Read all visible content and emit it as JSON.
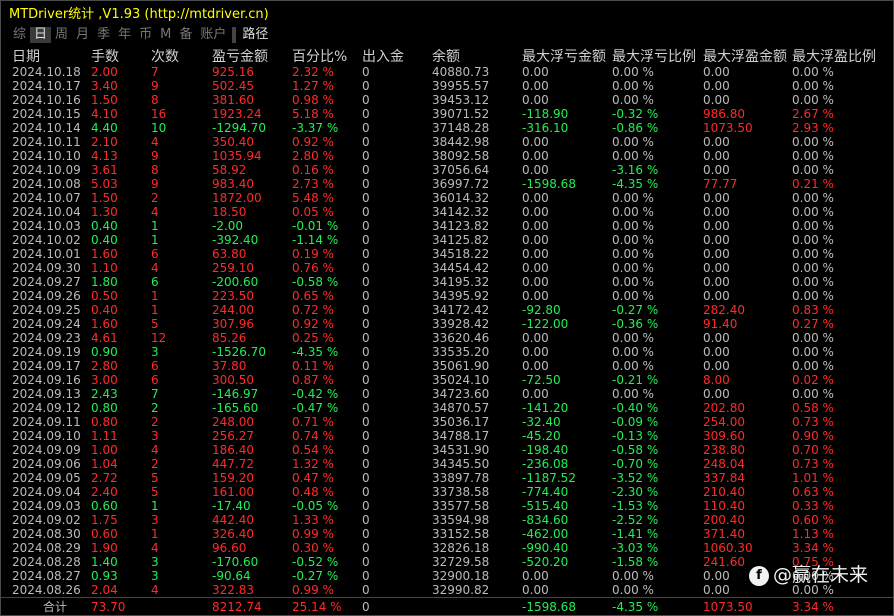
{
  "title": "MTDriver统计 ,V1.93 (http://mtdriver.cn)",
  "tabs": [
    {
      "label": "综",
      "state": "dim"
    },
    {
      "label": "日",
      "state": "sel"
    },
    {
      "label": "周",
      "state": "dim"
    },
    {
      "label": "月",
      "state": "dim"
    },
    {
      "label": "季",
      "state": "dim"
    },
    {
      "label": "年",
      "state": "dim"
    },
    {
      "label": "币",
      "state": "dim"
    },
    {
      "label": "M",
      "state": "dim"
    },
    {
      "label": "备",
      "state": "dim"
    },
    {
      "label": "账户",
      "state": "dim"
    },
    {
      "label": "路径",
      "state": "hl"
    }
  ],
  "columns": [
    "日期",
    "手数",
    "次数",
    "盈亏金额",
    "百分比%",
    "出入金",
    "余额",
    "最大浮亏金额",
    "最大浮亏比例",
    "最大浮盈金额",
    "最大浮盈比例"
  ],
  "colors": {
    "profit": "#ff2a2a",
    "loss": "#22ee55",
    "neutral": "#bbbbbb",
    "title": "#ffff00"
  },
  "rows": [
    {
      "date": "2024.10.18",
      "lots": "2.00",
      "count": "7",
      "pnl": "925.16",
      "pct": "2.32 %",
      "flow": "0",
      "bal": "40880.73",
      "mfl": "0.00",
      "mflp": "0.00 %",
      "mfp": "0.00",
      "mfpp": "0.00 %",
      "dir": "red",
      "fl": "gray",
      "fp": "gray"
    },
    {
      "date": "2024.10.17",
      "lots": "3.40",
      "count": "9",
      "pnl": "502.45",
      "pct": "1.27 %",
      "flow": "0",
      "bal": "39955.57",
      "mfl": "0.00",
      "mflp": "0.00 %",
      "mfp": "0.00",
      "mfpp": "0.00 %",
      "dir": "red",
      "fl": "gray",
      "fp": "gray"
    },
    {
      "date": "2024.10.16",
      "lots": "1.50",
      "count": "8",
      "pnl": "381.60",
      "pct": "0.98 %",
      "flow": "0",
      "bal": "39453.12",
      "mfl": "0.00",
      "mflp": "0.00 %",
      "mfp": "0.00",
      "mfpp": "0.00 %",
      "dir": "red",
      "fl": "gray",
      "fp": "gray"
    },
    {
      "date": "2024.10.15",
      "lots": "4.10",
      "count": "16",
      "pnl": "1923.24",
      "pct": "5.18 %",
      "flow": "0",
      "bal": "39071.52",
      "mfl": "-118.90",
      "mflp": "-0.32 %",
      "mfp": "986.80",
      "mfpp": "2.67 %",
      "dir": "red",
      "fl": "green",
      "fp": "red"
    },
    {
      "date": "2024.10.14",
      "lots": "4.40",
      "count": "10",
      "pnl": "-1294.70",
      "pct": "-3.37 %",
      "flow": "0",
      "bal": "37148.28",
      "mfl": "-316.10",
      "mflp": "-0.86 %",
      "mfp": "1073.50",
      "mfpp": "2.93 %",
      "dir": "green",
      "fl": "green",
      "fp": "red"
    },
    {
      "date": "2024.10.11",
      "lots": "2.10",
      "count": "4",
      "pnl": "350.40",
      "pct": "0.92 %",
      "flow": "0",
      "bal": "38442.98",
      "mfl": "0.00",
      "mflp": "0.00 %",
      "mfp": "0.00",
      "mfpp": "0.00 %",
      "dir": "red",
      "fl": "gray",
      "fp": "gray"
    },
    {
      "date": "2024.10.10",
      "lots": "4.13",
      "count": "9",
      "pnl": "1035.94",
      "pct": "2.80 %",
      "flow": "0",
      "bal": "38092.58",
      "mfl": "0.00",
      "mflp": "0.00 %",
      "mfp": "0.00",
      "mfpp": "0.00 %",
      "dir": "red",
      "fl": "gray",
      "fp": "gray"
    },
    {
      "date": "2024.10.09",
      "lots": "3.61",
      "count": "8",
      "pnl": "58.92",
      "pct": "0.16 %",
      "flow": "0",
      "bal": "37056.64",
      "mfl": "0.00",
      "mflp": "-3.16 %",
      "mfp": "0.00",
      "mfpp": "0.00 %",
      "dir": "red",
      "fl": "gray",
      "fp": "gray",
      "mflpc": "green"
    },
    {
      "date": "2024.10.08",
      "lots": "5.03",
      "count": "9",
      "pnl": "983.40",
      "pct": "2.73 %",
      "flow": "0",
      "bal": "36997.72",
      "mfl": "-1598.68",
      "mflp": "-4.35 %",
      "mfp": "77.77",
      "mfpp": "0.21 %",
      "dir": "red",
      "fl": "green",
      "fp": "red"
    },
    {
      "date": "2024.10.07",
      "lots": "1.50",
      "count": "2",
      "pnl": "1872.00",
      "pct": "5.48 %",
      "flow": "0",
      "bal": "36014.32",
      "mfl": "0.00",
      "mflp": "0.00 %",
      "mfp": "0.00",
      "mfpp": "0.00 %",
      "dir": "red",
      "fl": "gray",
      "fp": "gray"
    },
    {
      "date": "2024.10.04",
      "lots": "1.30",
      "count": "4",
      "pnl": "18.50",
      "pct": "0.05 %",
      "flow": "0",
      "bal": "34142.32",
      "mfl": "0.00",
      "mflp": "0.00 %",
      "mfp": "0.00",
      "mfpp": "0.00 %",
      "dir": "red",
      "fl": "gray",
      "fp": "gray"
    },
    {
      "date": "2024.10.03",
      "lots": "0.40",
      "count": "1",
      "pnl": "-2.00",
      "pct": "-0.01 %",
      "flow": "0",
      "bal": "34123.82",
      "mfl": "0.00",
      "mflp": "0.00 %",
      "mfp": "0.00",
      "mfpp": "0.00 %",
      "dir": "green",
      "fl": "gray",
      "fp": "gray"
    },
    {
      "date": "2024.10.02",
      "lots": "0.40",
      "count": "1",
      "pnl": "-392.40",
      "pct": "-1.14 %",
      "flow": "0",
      "bal": "34125.82",
      "mfl": "0.00",
      "mflp": "0.00 %",
      "mfp": "0.00",
      "mfpp": "0.00 %",
      "dir": "green",
      "fl": "gray",
      "fp": "gray"
    },
    {
      "date": "2024.10.01",
      "lots": "1.60",
      "count": "6",
      "pnl": "63.80",
      "pct": "0.19 %",
      "flow": "0",
      "bal": "34518.22",
      "mfl": "0.00",
      "mflp": "0.00 %",
      "mfp": "0.00",
      "mfpp": "0.00 %",
      "dir": "red",
      "fl": "gray",
      "fp": "gray"
    },
    {
      "date": "2024.09.30",
      "lots": "1.10",
      "count": "4",
      "pnl": "259.10",
      "pct": "0.76 %",
      "flow": "0",
      "bal": "34454.42",
      "mfl": "0.00",
      "mflp": "0.00 %",
      "mfp": "0.00",
      "mfpp": "0.00 %",
      "dir": "red",
      "fl": "gray",
      "fp": "gray"
    },
    {
      "date": "2024.09.27",
      "lots": "1.80",
      "count": "6",
      "pnl": "-200.60",
      "pct": "-0.58 %",
      "flow": "0",
      "bal": "34195.32",
      "mfl": "0.00",
      "mflp": "0.00 %",
      "mfp": "0.00",
      "mfpp": "0.00 %",
      "dir": "green",
      "fl": "gray",
      "fp": "gray"
    },
    {
      "date": "2024.09.26",
      "lots": "0.50",
      "count": "1",
      "pnl": "223.50",
      "pct": "0.65 %",
      "flow": "0",
      "bal": "34395.92",
      "mfl": "0.00",
      "mflp": "0.00 %",
      "mfp": "0.00",
      "mfpp": "0.00 %",
      "dir": "red",
      "fl": "gray",
      "fp": "gray"
    },
    {
      "date": "2024.09.25",
      "lots": "0.40",
      "count": "1",
      "pnl": "244.00",
      "pct": "0.72 %",
      "flow": "0",
      "bal": "34172.42",
      "mfl": "-92.80",
      "mflp": "-0.27 %",
      "mfp": "282.40",
      "mfpp": "0.83 %",
      "dir": "red",
      "fl": "green",
      "fp": "red"
    },
    {
      "date": "2024.09.24",
      "lots": "1.60",
      "count": "5",
      "pnl": "307.96",
      "pct": "0.92 %",
      "flow": "0",
      "bal": "33928.42",
      "mfl": "-122.00",
      "mflp": "-0.36 %",
      "mfp": "91.40",
      "mfpp": "0.27 %",
      "dir": "red",
      "fl": "green",
      "fp": "red"
    },
    {
      "date": "2024.09.23",
      "lots": "4.61",
      "count": "12",
      "pnl": "85.26",
      "pct": "0.25 %",
      "flow": "0",
      "bal": "33620.46",
      "mfl": "0.00",
      "mflp": "0.00 %",
      "mfp": "0.00",
      "mfpp": "0.00 %",
      "dir": "red",
      "fl": "gray",
      "fp": "gray"
    },
    {
      "date": "2024.09.19",
      "lots": "0.90",
      "count": "3",
      "pnl": "-1526.70",
      "pct": "-4.35 %",
      "flow": "0",
      "bal": "33535.20",
      "mfl": "0.00",
      "mflp": "0.00 %",
      "mfp": "0.00",
      "mfpp": "0.00 %",
      "dir": "green",
      "fl": "gray",
      "fp": "gray"
    },
    {
      "date": "2024.09.17",
      "lots": "2.80",
      "count": "6",
      "pnl": "37.80",
      "pct": "0.11 %",
      "flow": "0",
      "bal": "35061.90",
      "mfl": "0.00",
      "mflp": "0.00 %",
      "mfp": "0.00",
      "mfpp": "0.00 %",
      "dir": "red",
      "fl": "gray",
      "fp": "gray"
    },
    {
      "date": "2024.09.16",
      "lots": "3.00",
      "count": "6",
      "pnl": "300.50",
      "pct": "0.87 %",
      "flow": "0",
      "bal": "35024.10",
      "mfl": "-72.50",
      "mflp": "-0.21 %",
      "mfp": "8.00",
      "mfpp": "0.02 %",
      "dir": "red",
      "fl": "green",
      "fp": "red"
    },
    {
      "date": "2024.09.13",
      "lots": "2.43",
      "count": "7",
      "pnl": "-146.97",
      "pct": "-0.42 %",
      "flow": "0",
      "bal": "34723.60",
      "mfl": "0.00",
      "mflp": "0.00 %",
      "mfp": "0.00",
      "mfpp": "0.00 %",
      "dir": "green",
      "fl": "gray",
      "fp": "gray"
    },
    {
      "date": "2024.09.12",
      "lots": "0.80",
      "count": "2",
      "pnl": "-165.60",
      "pct": "-0.47 %",
      "flow": "0",
      "bal": "34870.57",
      "mfl": "-141.20",
      "mflp": "-0.40 %",
      "mfp": "202.80",
      "mfpp": "0.58 %",
      "dir": "green",
      "fl": "green",
      "fp": "red"
    },
    {
      "date": "2024.09.11",
      "lots": "0.80",
      "count": "2",
      "pnl": "248.00",
      "pct": "0.71 %",
      "flow": "0",
      "bal": "35036.17",
      "mfl": "-32.40",
      "mflp": "-0.09 %",
      "mfp": "254.00",
      "mfpp": "0.73 %",
      "dir": "red",
      "fl": "green",
      "fp": "red"
    },
    {
      "date": "2024.09.10",
      "lots": "1.11",
      "count": "3",
      "pnl": "256.27",
      "pct": "0.74 %",
      "flow": "0",
      "bal": "34788.17",
      "mfl": "-45.20",
      "mflp": "-0.13 %",
      "mfp": "309.60",
      "mfpp": "0.90 %",
      "dir": "red",
      "fl": "green",
      "fp": "red"
    },
    {
      "date": "2024.09.09",
      "lots": "1.00",
      "count": "4",
      "pnl": "186.40",
      "pct": "0.54 %",
      "flow": "0",
      "bal": "34531.90",
      "mfl": "-198.40",
      "mflp": "-0.58 %",
      "mfp": "238.80",
      "mfpp": "0.70 %",
      "dir": "red",
      "fl": "green",
      "fp": "red"
    },
    {
      "date": "2024.09.06",
      "lots": "1.04",
      "count": "2",
      "pnl": "447.72",
      "pct": "1.32 %",
      "flow": "0",
      "bal": "34345.50",
      "mfl": "-236.08",
      "mflp": "-0.70 %",
      "mfp": "248.04",
      "mfpp": "0.73 %",
      "dir": "red",
      "fl": "green",
      "fp": "red"
    },
    {
      "date": "2024.09.05",
      "lots": "2.72",
      "count": "5",
      "pnl": "159.20",
      "pct": "0.47 %",
      "flow": "0",
      "bal": "33897.78",
      "mfl": "-1187.52",
      "mflp": "-3.52 %",
      "mfp": "337.84",
      "mfpp": "1.01 %",
      "dir": "red",
      "fl": "green",
      "fp": "red"
    },
    {
      "date": "2024.09.04",
      "lots": "2.40",
      "count": "5",
      "pnl": "161.00",
      "pct": "0.48 %",
      "flow": "0",
      "bal": "33738.58",
      "mfl": "-774.40",
      "mflp": "-2.30 %",
      "mfp": "210.40",
      "mfpp": "0.63 %",
      "dir": "red",
      "fl": "green",
      "fp": "red"
    },
    {
      "date": "2024.09.03",
      "lots": "0.60",
      "count": "1",
      "pnl": "-17.40",
      "pct": "-0.05 %",
      "flow": "0",
      "bal": "33577.58",
      "mfl": "-515.40",
      "mflp": "-1.53 %",
      "mfp": "110.40",
      "mfpp": "0.33 %",
      "dir": "green",
      "fl": "green",
      "fp": "red"
    },
    {
      "date": "2024.09.02",
      "lots": "1.75",
      "count": "3",
      "pnl": "442.40",
      "pct": "1.33 %",
      "flow": "0",
      "bal": "33594.98",
      "mfl": "-834.60",
      "mflp": "-2.52 %",
      "mfp": "200.40",
      "mfpp": "0.60 %",
      "dir": "red",
      "fl": "green",
      "fp": "red"
    },
    {
      "date": "2024.08.30",
      "lots": "0.60",
      "count": "1",
      "pnl": "326.40",
      "pct": "0.99 %",
      "flow": "0",
      "bal": "33152.58",
      "mfl": "-462.00",
      "mflp": "-1.41 %",
      "mfp": "371.40",
      "mfpp": "1.13 %",
      "dir": "red",
      "fl": "green",
      "fp": "red"
    },
    {
      "date": "2024.08.29",
      "lots": "1.90",
      "count": "4",
      "pnl": "96.60",
      "pct": "0.30 %",
      "flow": "0",
      "bal": "32826.18",
      "mfl": "-990.40",
      "mflp": "-3.03 %",
      "mfp": "1060.30",
      "mfpp": "3.34 %",
      "dir": "red",
      "fl": "green",
      "fp": "red"
    },
    {
      "date": "2024.08.28",
      "lots": "1.40",
      "count": "3",
      "pnl": "-170.60",
      "pct": "-0.52 %",
      "flow": "0",
      "bal": "32729.58",
      "mfl": "-520.20",
      "mflp": "-1.58 %",
      "mfp": "241.60",
      "mfpp": "0.75 %",
      "dir": "green",
      "fl": "green",
      "fp": "red"
    },
    {
      "date": "2024.08.27",
      "lots": "0.93",
      "count": "3",
      "pnl": "-90.64",
      "pct": "-0.27 %",
      "flow": "0",
      "bal": "32900.18",
      "mfl": "0.00",
      "mflp": "0.00 %",
      "mfp": "0.00",
      "mfpp": "0.00 %",
      "dir": "green",
      "fl": "gray",
      "fp": "gray"
    },
    {
      "date": "2024.08.26",
      "lots": "2.04",
      "count": "4",
      "pnl": "322.83",
      "pct": "0.99 %",
      "flow": "0",
      "bal": "32990.82",
      "mfl": "0.00",
      "mflp": "0.00 %",
      "mfp": "0.00",
      "mfpp": "0.00 %",
      "dir": "red",
      "fl": "gray",
      "fp": "gray"
    }
  ],
  "total": {
    "label": "合计",
    "lots": "73.70",
    "count": "",
    "pnl": "8212.74",
    "pct": "25.14 %",
    "flow": "0",
    "bal": "",
    "mfl": "-1598.68",
    "mflp": "-4.35 %",
    "mfp": "1073.50",
    "mfpp": "3.34 %"
  },
  "watermark": {
    "icon": "f",
    "text": "@赢在未来"
  }
}
